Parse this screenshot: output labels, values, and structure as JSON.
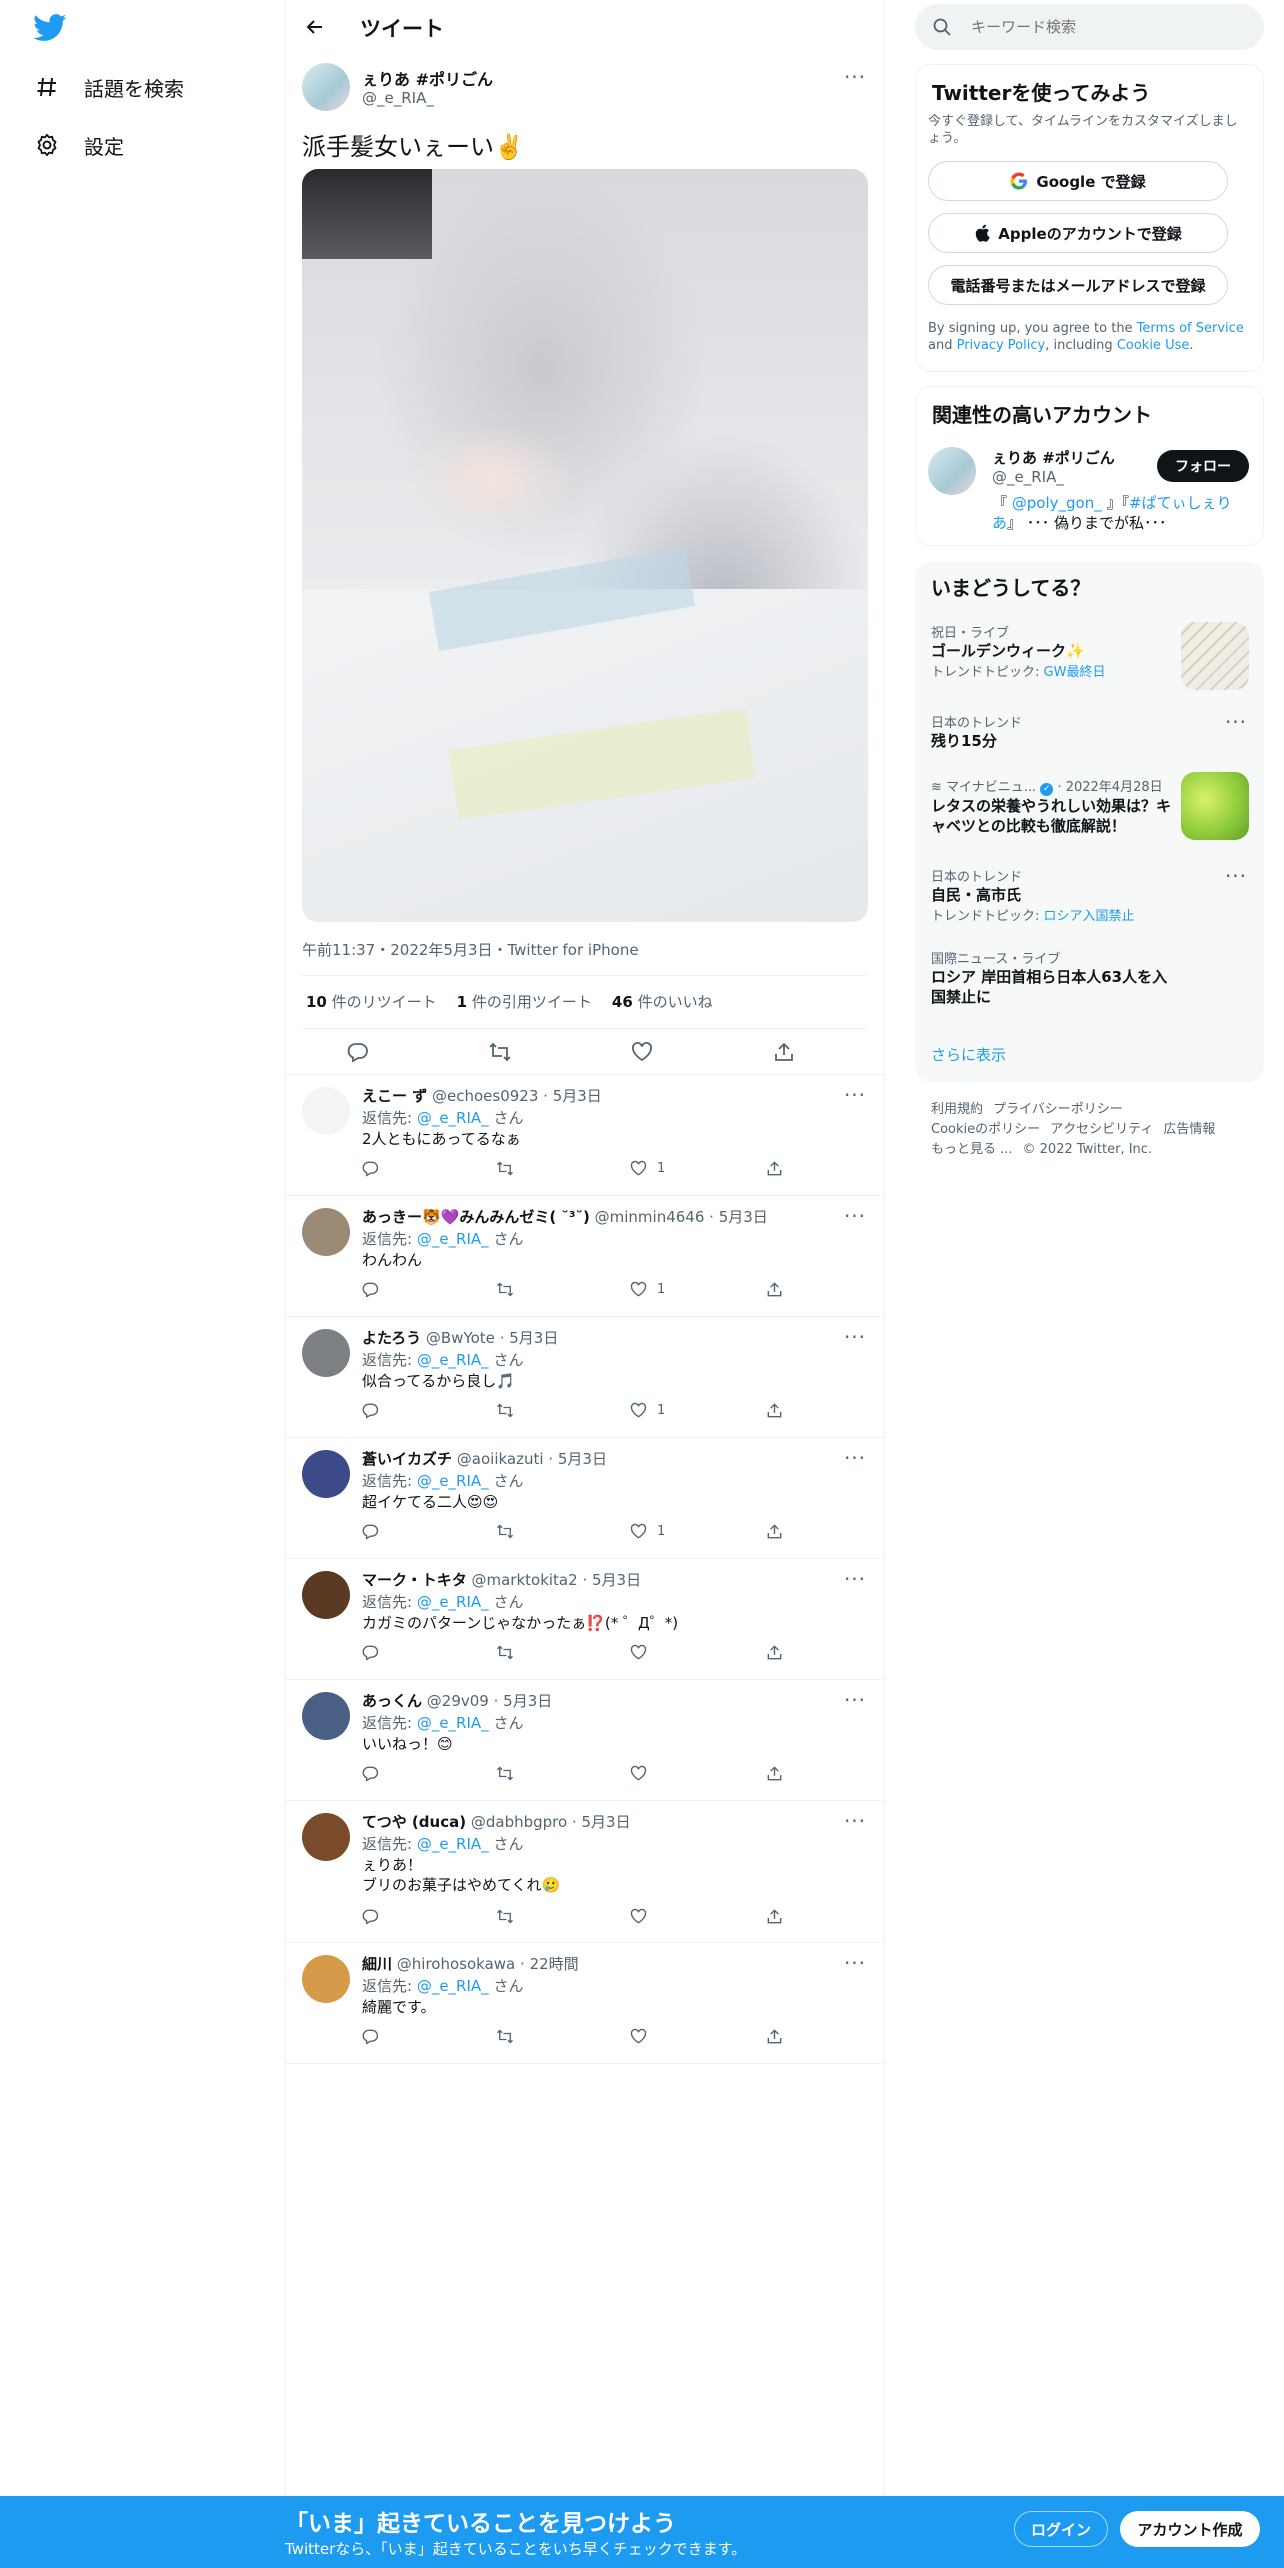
{
  "nav": {
    "items": [
      {
        "label": "話題を検索",
        "icon": "hashtag-icon"
      },
      {
        "label": "設定",
        "icon": "gear-icon"
      }
    ]
  },
  "header": {
    "title": "ツイート"
  },
  "tweet": {
    "name": "ぇりあ #ポリごん",
    "handle": "@_e_RIA_",
    "text": "派手髪女いぇーい✌️",
    "meta": "午前11:37・2022年5月3日・Twitter for iPhone",
    "retweets_count": "10",
    "retweets_label": "件のリツイート",
    "quotes_count": "1",
    "quotes_label": "件の引用ツイート",
    "likes_count": "46",
    "likes_label": "件のいいね"
  },
  "reply_prefix": "返信先: ",
  "reply_suffix": " さん",
  "replies": [
    {
      "name": "えこー ず",
      "handle": "@echoes0923",
      "date": "5月3日",
      "to": "@_e_RIA_",
      "text": "2人ともにあってるなぁ",
      "likes": "1",
      "avatar_color": "#f4f4f4"
    },
    {
      "name": "あっきー🐯💜みんみんゼミ( ˘³˘)",
      "handle": "@minmin4646",
      "date": "5月3日",
      "to": "@_e_RIA_",
      "text": "わんわん",
      "likes": "1",
      "avatar_color": "#9a8a76"
    },
    {
      "name": "よたろう",
      "handle": "@BwYote",
      "date": "5月3日",
      "to": "@_e_RIA_",
      "text": "似合ってるから良し🎵",
      "likes": "1",
      "avatar_color": "#7c7f83"
    },
    {
      "name": "蒼いイカズチ",
      "handle": "@aoiikazuti",
      "date": "5月3日",
      "to": "@_e_RIA_",
      "text": "超イケてる二人😍😍",
      "likes": "1",
      "avatar_color": "#3d4a8a"
    },
    {
      "name": "マーク・トキタ",
      "handle": "@marktokita2",
      "date": "5月3日",
      "to": "@_e_RIA_",
      "text": "カガミのパターンじゃなかったぁ⁉️(* ゜Д゜*)",
      "likes": "",
      "avatar_color": "#5a3a22"
    },
    {
      "name": "あっくん",
      "handle": "@29v09",
      "date": "5月3日",
      "to": "@_e_RIA_",
      "text": "いいねっ！😊",
      "likes": "",
      "avatar_color": "#4a5f86"
    },
    {
      "name": "てつや (duca)",
      "handle": "@dabhbgpro",
      "date": "5月3日",
      "to": "@_e_RIA_",
      "text": "ぇりあ！",
      "text2": "ブリのお菓子はやめてくれ🥲",
      "likes": "",
      "avatar_color": "#7a4b2a"
    },
    {
      "name": "細川",
      "handle": "@hirohosokawa",
      "date": "22時間",
      "to": "@_e_RIA_",
      "text": "綺麗です。",
      "likes": "",
      "avatar_color": "#d59a4a"
    }
  ],
  "search": {
    "placeholder": "キーワード検索"
  },
  "signup_card": {
    "title": "Twitterを使ってみよう",
    "subtitle": "今すぐ登録して、タイムラインをカスタマイズしましょう。",
    "google_label": "Google で登録",
    "apple_label": "Appleのアカウントで登録",
    "phone_label": "電話番号またはメールアドレスで登録",
    "legal_1": "By signing up, you agree to the ",
    "terms": "Terms of Service",
    "legal_2": " and ",
    "privacy": "Privacy Policy",
    "legal_3": ", including ",
    "cookie": "Cookie Use",
    "legal_4": "."
  },
  "related": {
    "title": "関連性の高いアカウント",
    "name": "ぇりあ #ポリごん",
    "handle": "@_e_RIA_",
    "follow_label": "フォロー",
    "bio_1": "『 ",
    "bio_link1": "@poly_gon_",
    "bio_2": " 』『",
    "bio_link2": "#ぱてぃしぇりあ",
    "bio_3": "』 ･･･ 偽りまでが私･･･"
  },
  "trends": {
    "title": "いまどうしてる？",
    "items": [
      {
        "category": "祝日・ライブ",
        "name": "ゴールデンウィーク✨",
        "sub_label": "トレンドトピック: ",
        "sub_link": "GW最終日"
      },
      {
        "category": "日本のトレンド",
        "name": "残り15分"
      },
      {
        "source": "マイナビニュ...",
        "date": "2022年4月28日",
        "name": "レタスの栄養やうれしい効果は？キャベツとの比較も徹底解説！"
      },
      {
        "category": "日本のトレンド",
        "name": "自民・高市氏",
        "sub_label": "トレンドトピック: ",
        "sub_link": "ロシア入国禁止"
      },
      {
        "category": "国際ニュース・ライブ",
        "name": "ロシア 岸田首相ら日本人63人を入国禁止に"
      }
    ],
    "show_more": "さらに表示"
  },
  "footer": {
    "links": [
      "利用規約",
      "プライバシーポリシー",
      "Cookieのポリシー",
      "アクセシビリティ",
      "広告情報",
      "もっと見る ..."
    ],
    "copyright": "© 2022 Twitter, Inc."
  },
  "bottombar": {
    "title": "「いま」起きていることを見つけよう",
    "subtitle": "Twitterなら、「いま」起きていることをいち早くチェックできます。",
    "login_label": "ログイン",
    "signup_label": "アカウント作成"
  }
}
